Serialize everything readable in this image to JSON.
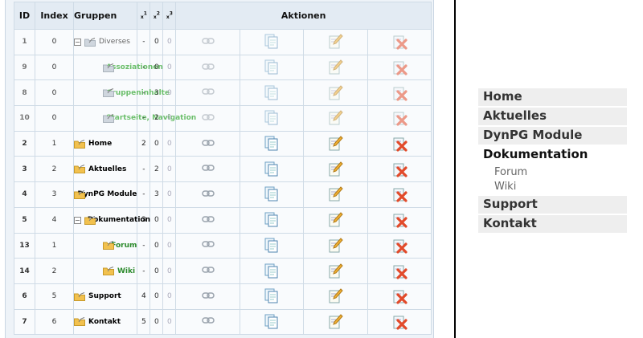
{
  "table": {
    "headers": {
      "id": "ID",
      "index": "Index",
      "groups": "Gruppen",
      "x1": "1",
      "x2": "2",
      "x3": "3",
      "actions": "Aktionen"
    },
    "rows": [
      {
        "id": "1",
        "index": "0",
        "name": "Diverses",
        "x1": "-",
        "x2": "0",
        "x3": "0",
        "indent": 0,
        "toggle": "−",
        "style": "grey",
        "dim": true
      },
      {
        "id": "9",
        "index": "0",
        "name": "Assoziationen",
        "x1": "-",
        "x2": "0",
        "x3": "0",
        "indent": 1,
        "toggle": "",
        "style": "lgreen",
        "dim": true
      },
      {
        "id": "8",
        "index": "0",
        "name": "Gruppeninhalte",
        "x1": "-",
        "x2": "3",
        "x3": "0",
        "indent": 1,
        "toggle": "",
        "style": "lgreen",
        "dim": true
      },
      {
        "id": "10",
        "index": "0",
        "name": "Startseite, Navigation",
        "x1": "-",
        "x2": "2",
        "x3": "0",
        "indent": 1,
        "toggle": "",
        "style": "lgreen",
        "dim": true
      },
      {
        "id": "2",
        "index": "1",
        "name": "Home",
        "x1": "2",
        "x2": "0",
        "x3": "0",
        "indent": 0,
        "toggle": "",
        "style": "b",
        "dim": false
      },
      {
        "id": "3",
        "index": "2",
        "name": "Aktuelles",
        "x1": "-",
        "x2": "2",
        "x3": "0",
        "indent": 0,
        "toggle": "",
        "style": "b",
        "dim": false
      },
      {
        "id": "4",
        "index": "3",
        "name": "DynPG Module",
        "x1": "-",
        "x2": "3",
        "x3": "0",
        "indent": 0,
        "toggle": "",
        "style": "b",
        "dim": false
      },
      {
        "id": "5",
        "index": "4",
        "name": "Dokumentation",
        "x1": "3",
        "x2": "0",
        "x3": "0",
        "indent": 0,
        "toggle": "−",
        "style": "b",
        "dim": false
      },
      {
        "id": "13",
        "index": "1",
        "name": "Forum",
        "x1": "-",
        "x2": "0",
        "x3": "0",
        "indent": 1,
        "toggle": "",
        "style": "green",
        "dim": false
      },
      {
        "id": "14",
        "index": "2",
        "name": "Wiki",
        "x1": "-",
        "x2": "0",
        "x3": "0",
        "indent": 1,
        "toggle": "",
        "style": "green",
        "dim": false
      },
      {
        "id": "6",
        "index": "5",
        "name": "Support",
        "x1": "4",
        "x2": "0",
        "x3": "0",
        "indent": 0,
        "toggle": "",
        "style": "b",
        "dim": false
      },
      {
        "id": "7",
        "index": "6",
        "name": "Kontakt",
        "x1": "5",
        "x2": "0",
        "x3": "0",
        "indent": 0,
        "toggle": "",
        "style": "b",
        "dim": false
      }
    ],
    "action_icons": [
      "link-icon",
      "copy-icon",
      "edit-icon",
      "delete-icon"
    ]
  },
  "nav": {
    "items": [
      {
        "label": "Home",
        "active": false
      },
      {
        "label": "Aktuelles",
        "active": false
      },
      {
        "label": "DynPG Module",
        "active": false
      },
      {
        "label": "Dokumentation",
        "active": true,
        "children": [
          "Forum",
          "Wiki"
        ]
      },
      {
        "label": "Support",
        "active": false
      },
      {
        "label": "Kontakt",
        "active": false
      }
    ]
  },
  "colors": {
    "panel_bg": "#eef3f8",
    "header_bg": "#e3ebf3",
    "green": "#2b8a2b",
    "light_green": "#6cbf6c",
    "nav_bg": "#eeeeee"
  }
}
